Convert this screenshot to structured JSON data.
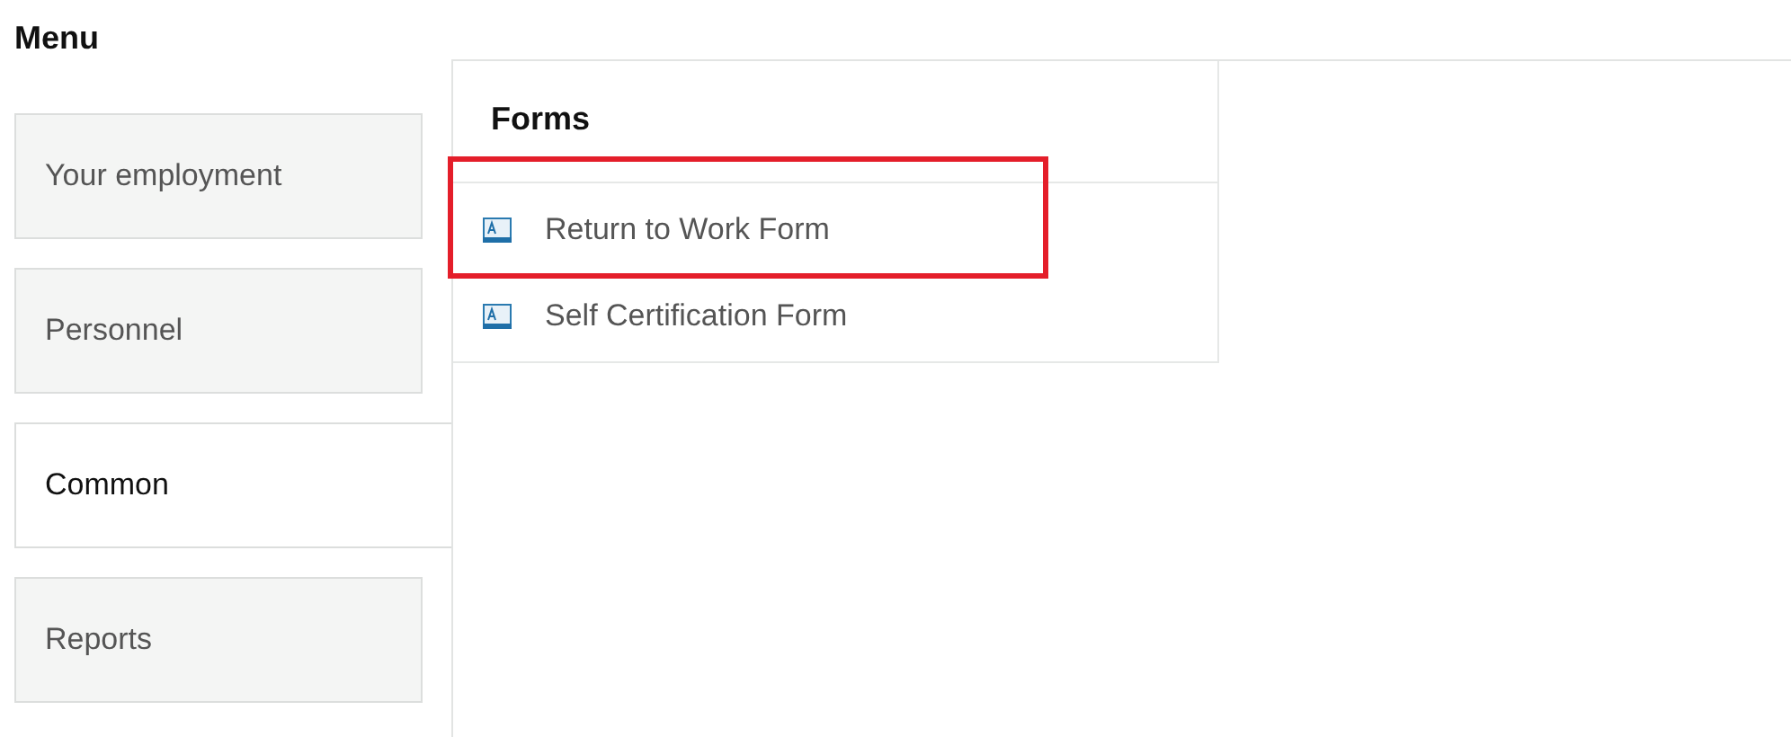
{
  "title": "Menu",
  "menu": [
    {
      "label": "Your employment",
      "selected": false
    },
    {
      "label": "Personnel",
      "selected": false
    },
    {
      "label": "Common",
      "selected": true
    },
    {
      "label": "Reports",
      "selected": false
    }
  ],
  "forms": {
    "heading": "Forms",
    "items": [
      {
        "label": "Return to Work Form",
        "highlighted": true
      },
      {
        "label": "Self Certification Form",
        "highlighted": false
      }
    ]
  }
}
